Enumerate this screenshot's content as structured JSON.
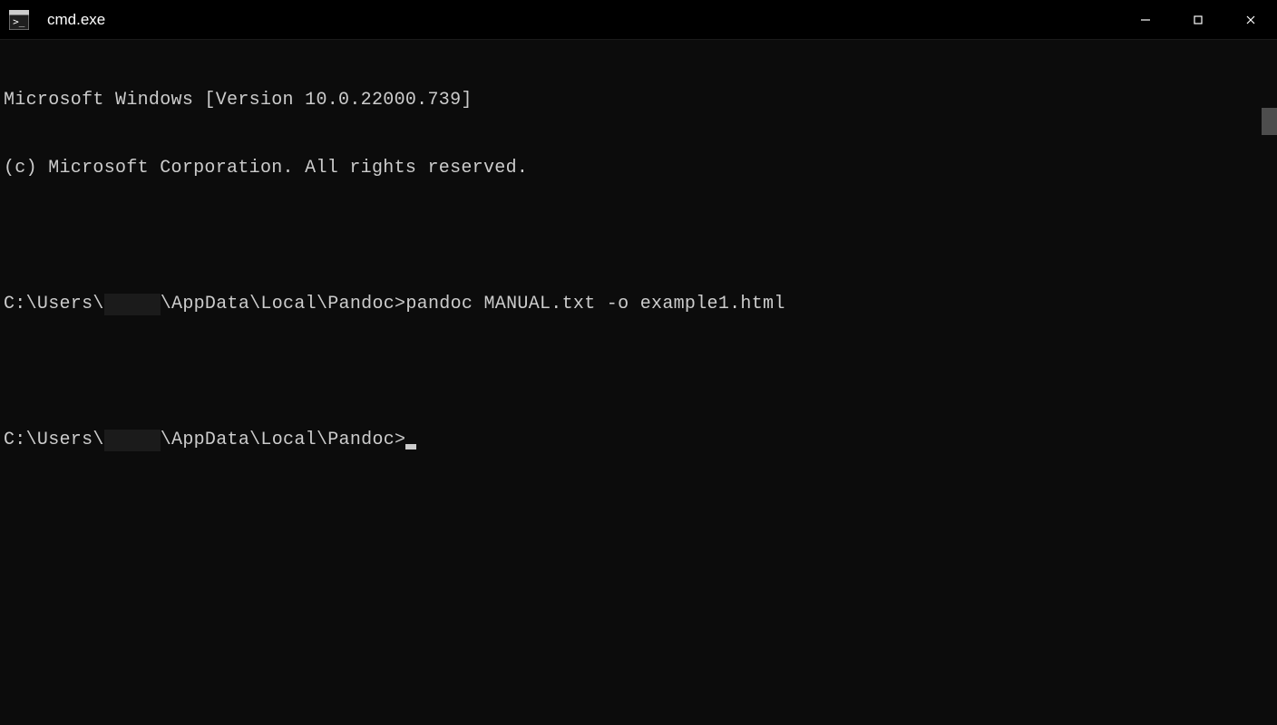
{
  "window": {
    "title": "cmd.exe"
  },
  "terminal": {
    "banner_line1": "Microsoft Windows [Version 10.0.22000.739]",
    "banner_line2": "(c) Microsoft Corporation. All rights reserved.",
    "prompt_prefix": "C:\\Users\\",
    "prompt_suffix": "\\AppData\\Local\\Pandoc>",
    "command1": "pandoc MANUAL.txt -o example1.html"
  }
}
